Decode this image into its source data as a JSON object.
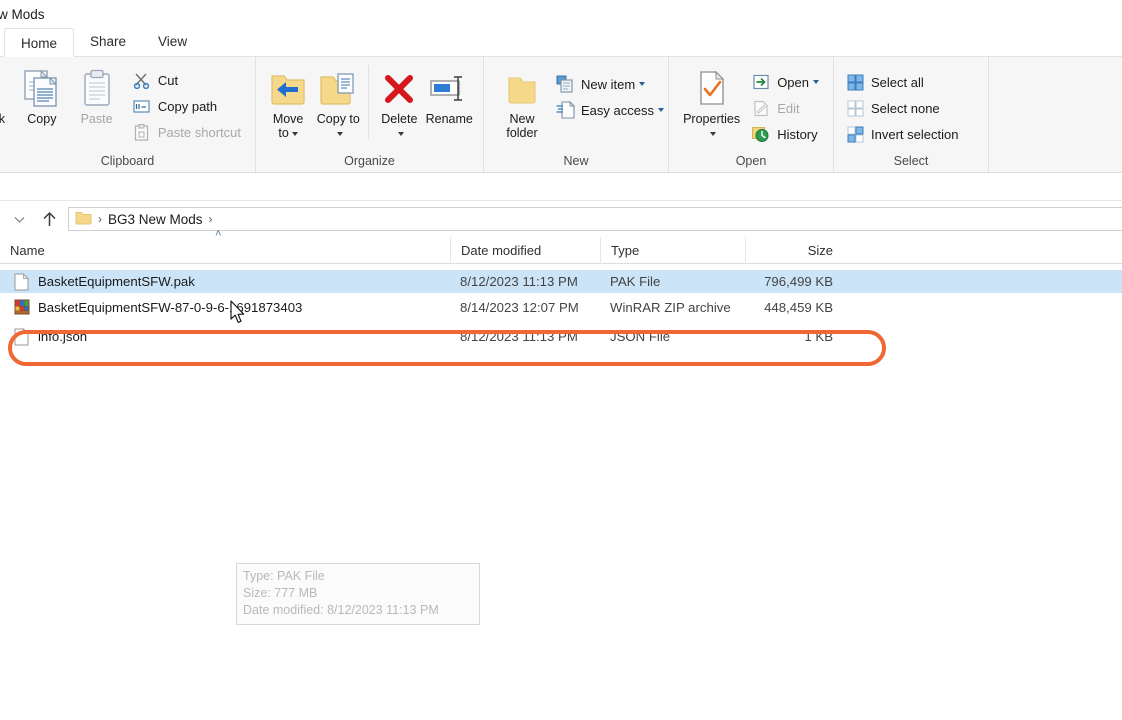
{
  "window": {
    "title": "w Mods"
  },
  "tabs": [
    {
      "label": "Home",
      "active": true
    },
    {
      "label": "Share",
      "active": false
    },
    {
      "label": "View",
      "active": false
    }
  ],
  "ribbon": {
    "groups": [
      {
        "name": "clipboard",
        "label": "Clipboard",
        "big": [
          {
            "label": "ck",
            "icon": "pin-quick-access-icon",
            "disabled": false
          },
          {
            "label": "Copy",
            "icon": "copy-icon",
            "disabled": false
          },
          {
            "label": "Paste",
            "icon": "paste-icon",
            "disabled": true
          }
        ],
        "small": [
          {
            "label": "Cut",
            "icon": "scissors-icon",
            "disabled": false
          },
          {
            "label": "Copy path",
            "icon": "copy-path-icon",
            "disabled": false
          },
          {
            "label": "Paste shortcut",
            "icon": "paste-shortcut-icon",
            "disabled": true
          }
        ]
      },
      {
        "name": "organize",
        "label": "Organize",
        "big": [
          {
            "label": "Move to",
            "icon": "move-to-folder-icon",
            "dropdown": true
          },
          {
            "label": "Copy to",
            "icon": "copy-to-folder-icon",
            "dropdown": true
          },
          {
            "label": "Delete",
            "icon": "delete-x-icon",
            "dropdown": true
          },
          {
            "label": "Rename",
            "icon": "rename-icon",
            "dropdown": false
          }
        ]
      },
      {
        "name": "new",
        "label": "New",
        "big": [
          {
            "label": "New folder",
            "icon": "new-folder-icon"
          }
        ],
        "small": [
          {
            "label": "New item",
            "icon": "new-item-icon",
            "dropdown": true
          },
          {
            "label": "Easy access",
            "icon": "easy-access-icon",
            "dropdown": true
          }
        ]
      },
      {
        "name": "open",
        "label": "Open",
        "big": [
          {
            "label": "Properties",
            "icon": "properties-icon",
            "dropdown": true
          }
        ],
        "small": [
          {
            "label": "Open",
            "icon": "open-icon",
            "dropdown": true,
            "disabled": false
          },
          {
            "label": "Edit",
            "icon": "edit-icon",
            "disabled": true
          },
          {
            "label": "History",
            "icon": "history-icon",
            "disabled": false
          }
        ]
      },
      {
        "name": "select",
        "label": "Select",
        "small": [
          {
            "label": "Select all",
            "icon": "select-all-icon"
          },
          {
            "label": "Select none",
            "icon": "select-none-icon"
          },
          {
            "label": "Invert selection",
            "icon": "invert-selection-icon"
          }
        ]
      }
    ]
  },
  "navbar": {
    "down_icon": "chevron-down-icon",
    "up_icon": "up-arrow-icon",
    "folder_icon": "folder-icon",
    "breadcrumb": [
      "BG3 New Mods"
    ],
    "separator": "›"
  },
  "filelist": {
    "columns": [
      {
        "key": "name",
        "label": "Name",
        "sort": "asc"
      },
      {
        "key": "date",
        "label": "Date modified"
      },
      {
        "key": "type",
        "label": "Type"
      },
      {
        "key": "size",
        "label": "Size"
      }
    ],
    "sort_caret": "˄",
    "rows": [
      {
        "name": "BasketEquipmentSFW.pak",
        "date": "8/12/2023 11:13 PM",
        "type": "PAK File",
        "size": "796,499 KB",
        "icon": "generic-file-icon",
        "selected": true
      },
      {
        "name": "BasketEquipmentSFW-87-0-9-6-1691873403",
        "date": "8/14/2023 12:07 PM",
        "type": "WinRAR ZIP archive",
        "size": "448,459 KB",
        "icon": "winrar-archive-icon",
        "selected": false
      },
      {
        "name": "info.json",
        "date": "8/12/2023 11:13 PM",
        "type": "JSON File",
        "size": "1 KB",
        "icon": "generic-file-icon",
        "selected": false
      }
    ]
  },
  "tooltip": {
    "line1": "Type: PAK File",
    "line2": "Size: 777 MB",
    "line3": "Date modified: 8/12/2023 11:13 PM"
  },
  "annotation": {
    "shape": "oval-highlight",
    "color": "#ef6733"
  },
  "colors": {
    "selection": "#cce4f7",
    "ribbon_bg": "#f6f6f7",
    "accent_orange": "#ef6733"
  }
}
